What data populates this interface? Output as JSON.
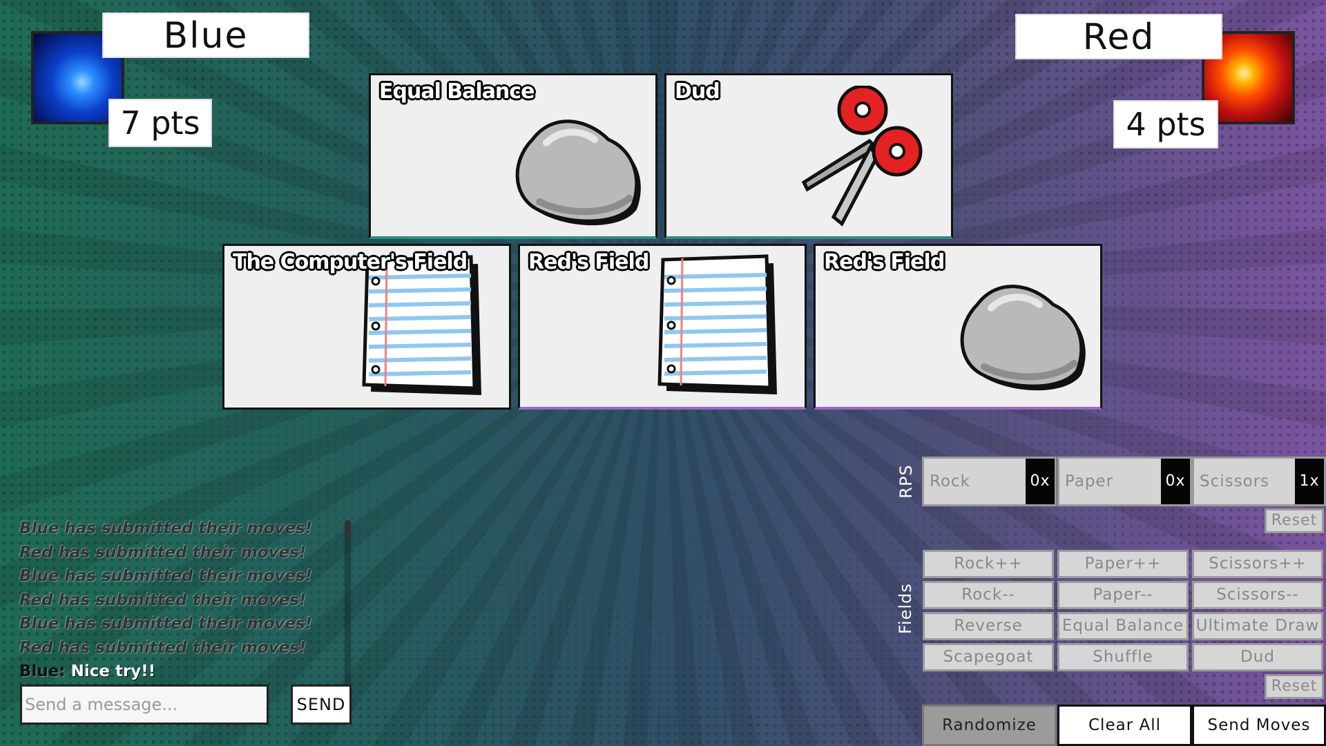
{
  "players": {
    "blue": {
      "name": "Blue",
      "points": "7 pts",
      "avatar_icon": "blue-phoenix-avatar"
    },
    "red": {
      "name": "Red",
      "points": "4 pts",
      "avatar_icon": "red-phoenix-avatar"
    }
  },
  "cards": [
    {
      "title": "Equal Balance",
      "art": "rock-icon"
    },
    {
      "title": "Dud",
      "art": "scissors-icon"
    },
    {
      "title": "The Computer's Field",
      "art": "paper-icon"
    },
    {
      "title": "Red's Field",
      "art": "paper-icon"
    },
    {
      "title": "Red's Field",
      "art": "rock-icon"
    }
  ],
  "chat": {
    "log": [
      "Blue has submitted their moves!",
      "Red has submitted their moves!",
      "Blue has submitted their moves!",
      "Red has submitted their moves!",
      "Blue has submitted their moves!",
      "Red has submitted their moves!"
    ],
    "last_message": {
      "sender": "Blue:",
      "text": " Nice try!!"
    },
    "input_placeholder": "Send a message...",
    "send_label": "SEND"
  },
  "rps": {
    "section_label": "RPS",
    "buttons": [
      {
        "label": "Rock",
        "count": "0x"
      },
      {
        "label": "Paper",
        "count": "0x"
      },
      {
        "label": "Scissors",
        "count": "1x"
      }
    ],
    "reset_label": "Reset"
  },
  "fields": {
    "section_label": "Fields",
    "buttons": [
      "Rock++",
      "Paper++",
      "Scissors++",
      "Rock--",
      "Paper--",
      "Scissors--",
      "Reverse",
      "Equal Balance",
      "Ultimate Draw",
      "Scapegoat",
      "Shuffle",
      "Dud"
    ],
    "reset_label": "Reset"
  },
  "actions": {
    "randomize": "Randomize",
    "clear_all": "Clear All",
    "send_moves": "Send Moves"
  }
}
